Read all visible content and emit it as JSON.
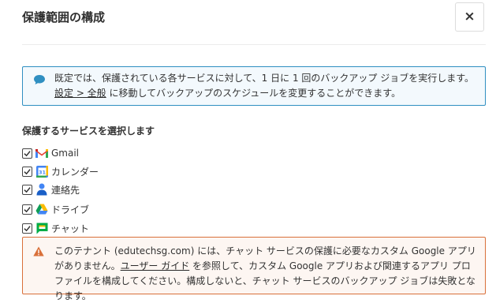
{
  "dialog": {
    "title": "保護範囲の構成",
    "close_label": "×"
  },
  "info": {
    "text_before": "既定では、保護されている各サービスに対して、1 日に 1 回のバックアップ ジョブを実行します。",
    "link": "設定 > 全般",
    "text_after": " に移動してバックアップのスケジュールを変更することができます。",
    "icon": "speech-bubble-icon"
  },
  "services": {
    "label": "保護するサービスを選択します",
    "items": [
      {
        "label": "Gmail",
        "checked": true,
        "icon": "gmail-icon"
      },
      {
        "label": "カレンダー",
        "checked": true,
        "icon": "calendar-icon"
      },
      {
        "label": "連絡先",
        "checked": true,
        "icon": "contacts-icon"
      },
      {
        "label": "ドライブ",
        "checked": true,
        "icon": "drive-icon"
      },
      {
        "label": "チャット",
        "checked": true,
        "icon": "chat-icon"
      }
    ]
  },
  "warning": {
    "text_before": "このテナント (edutechsg.com) には、チャット サービスの保護に必要なカスタム Google アプリがありません。",
    "link": "ユーザー ガイド",
    "text_after": " を参照して、カスタム Google アプリおよび関連するアプリ プロファイルを構成してください。構成しないと、チャット サービスのバックアップ ジョブは失敗となります。",
    "icon": "warning-triangle-icon",
    "color": "#d9703a"
  },
  "colors": {
    "info_border": "#2f8fc1",
    "info_bg": "#f3f9fd",
    "warning_border": "#d9703a",
    "warning_bg": "#fdf6f2"
  }
}
